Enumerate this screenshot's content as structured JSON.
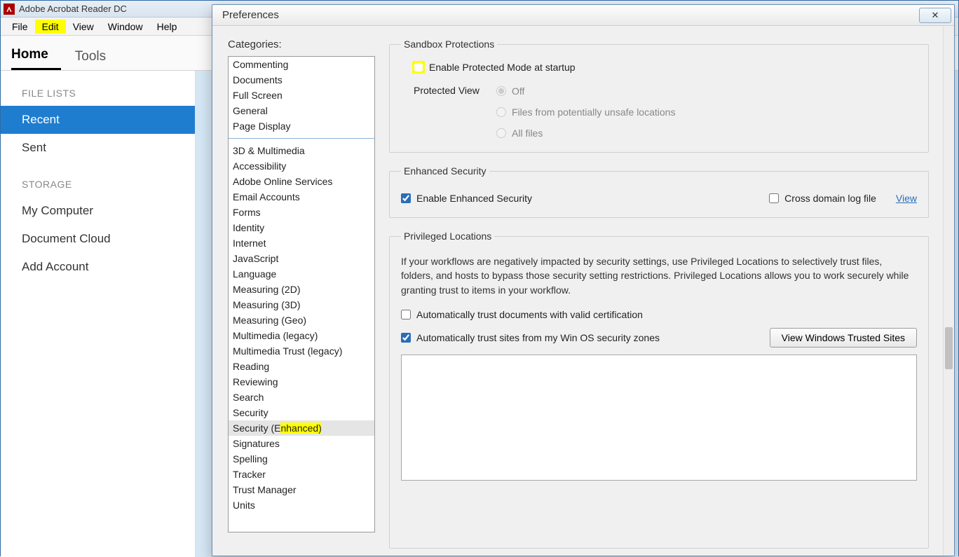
{
  "app": {
    "title": "Adobe Acrobat Reader DC",
    "menu": [
      "File",
      "Edit",
      "View",
      "Window",
      "Help"
    ],
    "menu_highlight_index": 1,
    "tabs": [
      "Home",
      "Tools"
    ],
    "tab_active_index": 0
  },
  "left_pane": {
    "section1_label": "FILE LISTS",
    "items1": [
      "Recent",
      "Sent"
    ],
    "items1_selected_index": 0,
    "section2_label": "STORAGE",
    "items2": [
      "My Computer",
      "Document Cloud",
      "Add Account"
    ]
  },
  "dialog": {
    "title": "Preferences",
    "categories_heading": "Categories:",
    "categories_group1": [
      "Commenting",
      "Documents",
      "Full Screen",
      "General",
      "Page Display"
    ],
    "categories_group2": [
      "3D & Multimedia",
      "Accessibility",
      "Adobe Online Services",
      "Email Accounts",
      "Forms",
      "Identity",
      "Internet",
      "JavaScript",
      "Language",
      "Measuring (2D)",
      "Measuring (3D)",
      "Measuring (Geo)",
      "Multimedia (legacy)",
      "Multimedia Trust (legacy)",
      "Reading",
      "Reviewing",
      "Search",
      "Security",
      "Security (Enhanced)",
      "Signatures",
      "Spelling",
      "Tracker",
      "Trust Manager",
      "Units"
    ],
    "categories_selected": "Security (Enhanced)",
    "categories_highlighted": "Security (Enhanced)"
  },
  "sandbox": {
    "legend": "Sandbox Protections",
    "enable_protected": "Enable Protected Mode at startup",
    "enable_protected_checked": false,
    "protected_view_label": "Protected View",
    "pv_options": [
      "Off",
      "Files from potentially unsafe locations",
      "All files"
    ],
    "pv_selected_index": 0
  },
  "enhanced": {
    "legend": "Enhanced Security",
    "enable_es": "Enable Enhanced Security",
    "enable_es_checked": true,
    "cross_domain": "Cross domain log file",
    "cross_domain_checked": false,
    "view_link": "View"
  },
  "privileged": {
    "legend": "Privileged Locations",
    "description": "If your workflows are negatively impacted by security settings, use Privileged Locations to selectively trust files, folders, and hosts to bypass those security setting restrictions. Privileged Locations allows you to work securely while granting trust to items in your workflow.",
    "auto_trust_cert": "Automatically trust documents with valid certification",
    "auto_trust_cert_checked": false,
    "auto_trust_zones": "Automatically trust sites from my Win OS security zones",
    "auto_trust_zones_checked": true,
    "view_trusted_btn": "View Windows Trusted Sites"
  }
}
